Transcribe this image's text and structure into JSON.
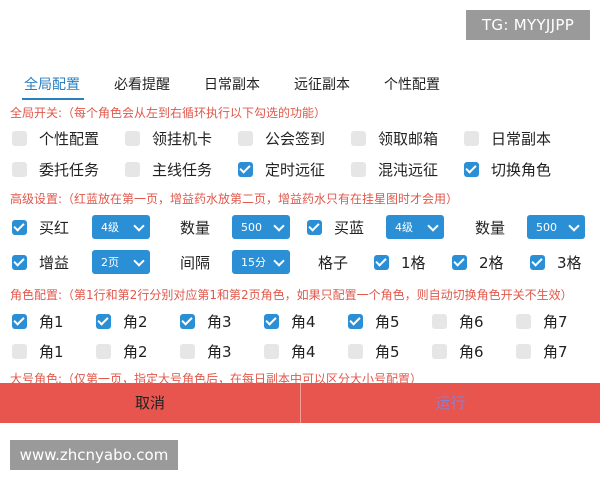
{
  "watermark_top": "TG: MYYJJPP",
  "watermark_bottom": "www.zhcnyabo.com",
  "tabs": [
    "全局配置",
    "必看提醒",
    "日常副本",
    "远征副本",
    "个性配置"
  ],
  "sections": {
    "global": "全局开关:（每个角色会从左到右循环执行以下勾选的功能）",
    "advanced": "高级设置:（红蓝放在第一页，增益药水放第二页，增益药水只有在挂星图时才会用）",
    "roles": "角色配置:（第1行和第2行分别对应第1和第2页角色，如果只配置一个角色，则自动切换角色开关不生效）",
    "big_roles": "大号角色:（仅第一页，指定大号角色后，在每日副本中可以区分大小号配置）"
  },
  "global_switches": [
    {
      "label": "个性配置",
      "checked": false
    },
    {
      "label": "领挂机卡",
      "checked": false
    },
    {
      "label": "公会签到",
      "checked": false
    },
    {
      "label": "领取邮箱",
      "checked": false
    },
    {
      "label": "日常副本",
      "checked": false
    },
    {
      "label": "委托任务",
      "checked": false
    },
    {
      "label": "主线任务",
      "checked": false
    },
    {
      "label": "定时远征",
      "checked": true
    },
    {
      "label": "混沌远征",
      "checked": false
    },
    {
      "label": "切换角色",
      "checked": true
    }
  ],
  "advanced": {
    "red": {
      "label": "买红",
      "checked": true,
      "level": "4级",
      "qty_label": "数量",
      "qty": "500"
    },
    "blue": {
      "label": "买蓝",
      "checked": true,
      "level": "4级",
      "qty_label": "数量",
      "qty": "500"
    },
    "buff": {
      "label": "增益",
      "checked": true,
      "page": "2页",
      "interval_label": "间隔",
      "interval": "15分"
    },
    "grid_label": "格子",
    "grids": [
      {
        "label": "1格",
        "checked": true
      },
      {
        "label": "2格",
        "checked": true
      },
      {
        "label": "3格",
        "checked": true
      }
    ]
  },
  "roles_row1": [
    {
      "label": "角1",
      "checked": true
    },
    {
      "label": "角2",
      "checked": true
    },
    {
      "label": "角3",
      "checked": true
    },
    {
      "label": "角4",
      "checked": true
    },
    {
      "label": "角5",
      "checked": true
    },
    {
      "label": "角6",
      "checked": false
    },
    {
      "label": "角7",
      "checked": false
    }
  ],
  "roles_row2": [
    {
      "label": "角1",
      "checked": false
    },
    {
      "label": "角2",
      "checked": false
    },
    {
      "label": "角3",
      "checked": false
    },
    {
      "label": "角4",
      "checked": false
    },
    {
      "label": "角5",
      "checked": false
    },
    {
      "label": "角6",
      "checked": false
    },
    {
      "label": "角7",
      "checked": false
    }
  ],
  "buttons": {
    "cancel": "取消",
    "run": "运行"
  },
  "colors": {
    "accent": "#2b8fd6",
    "tab_active": "#2a7fc1",
    "section_text": "#e0584c",
    "bottom_bar": "#e8554e"
  }
}
